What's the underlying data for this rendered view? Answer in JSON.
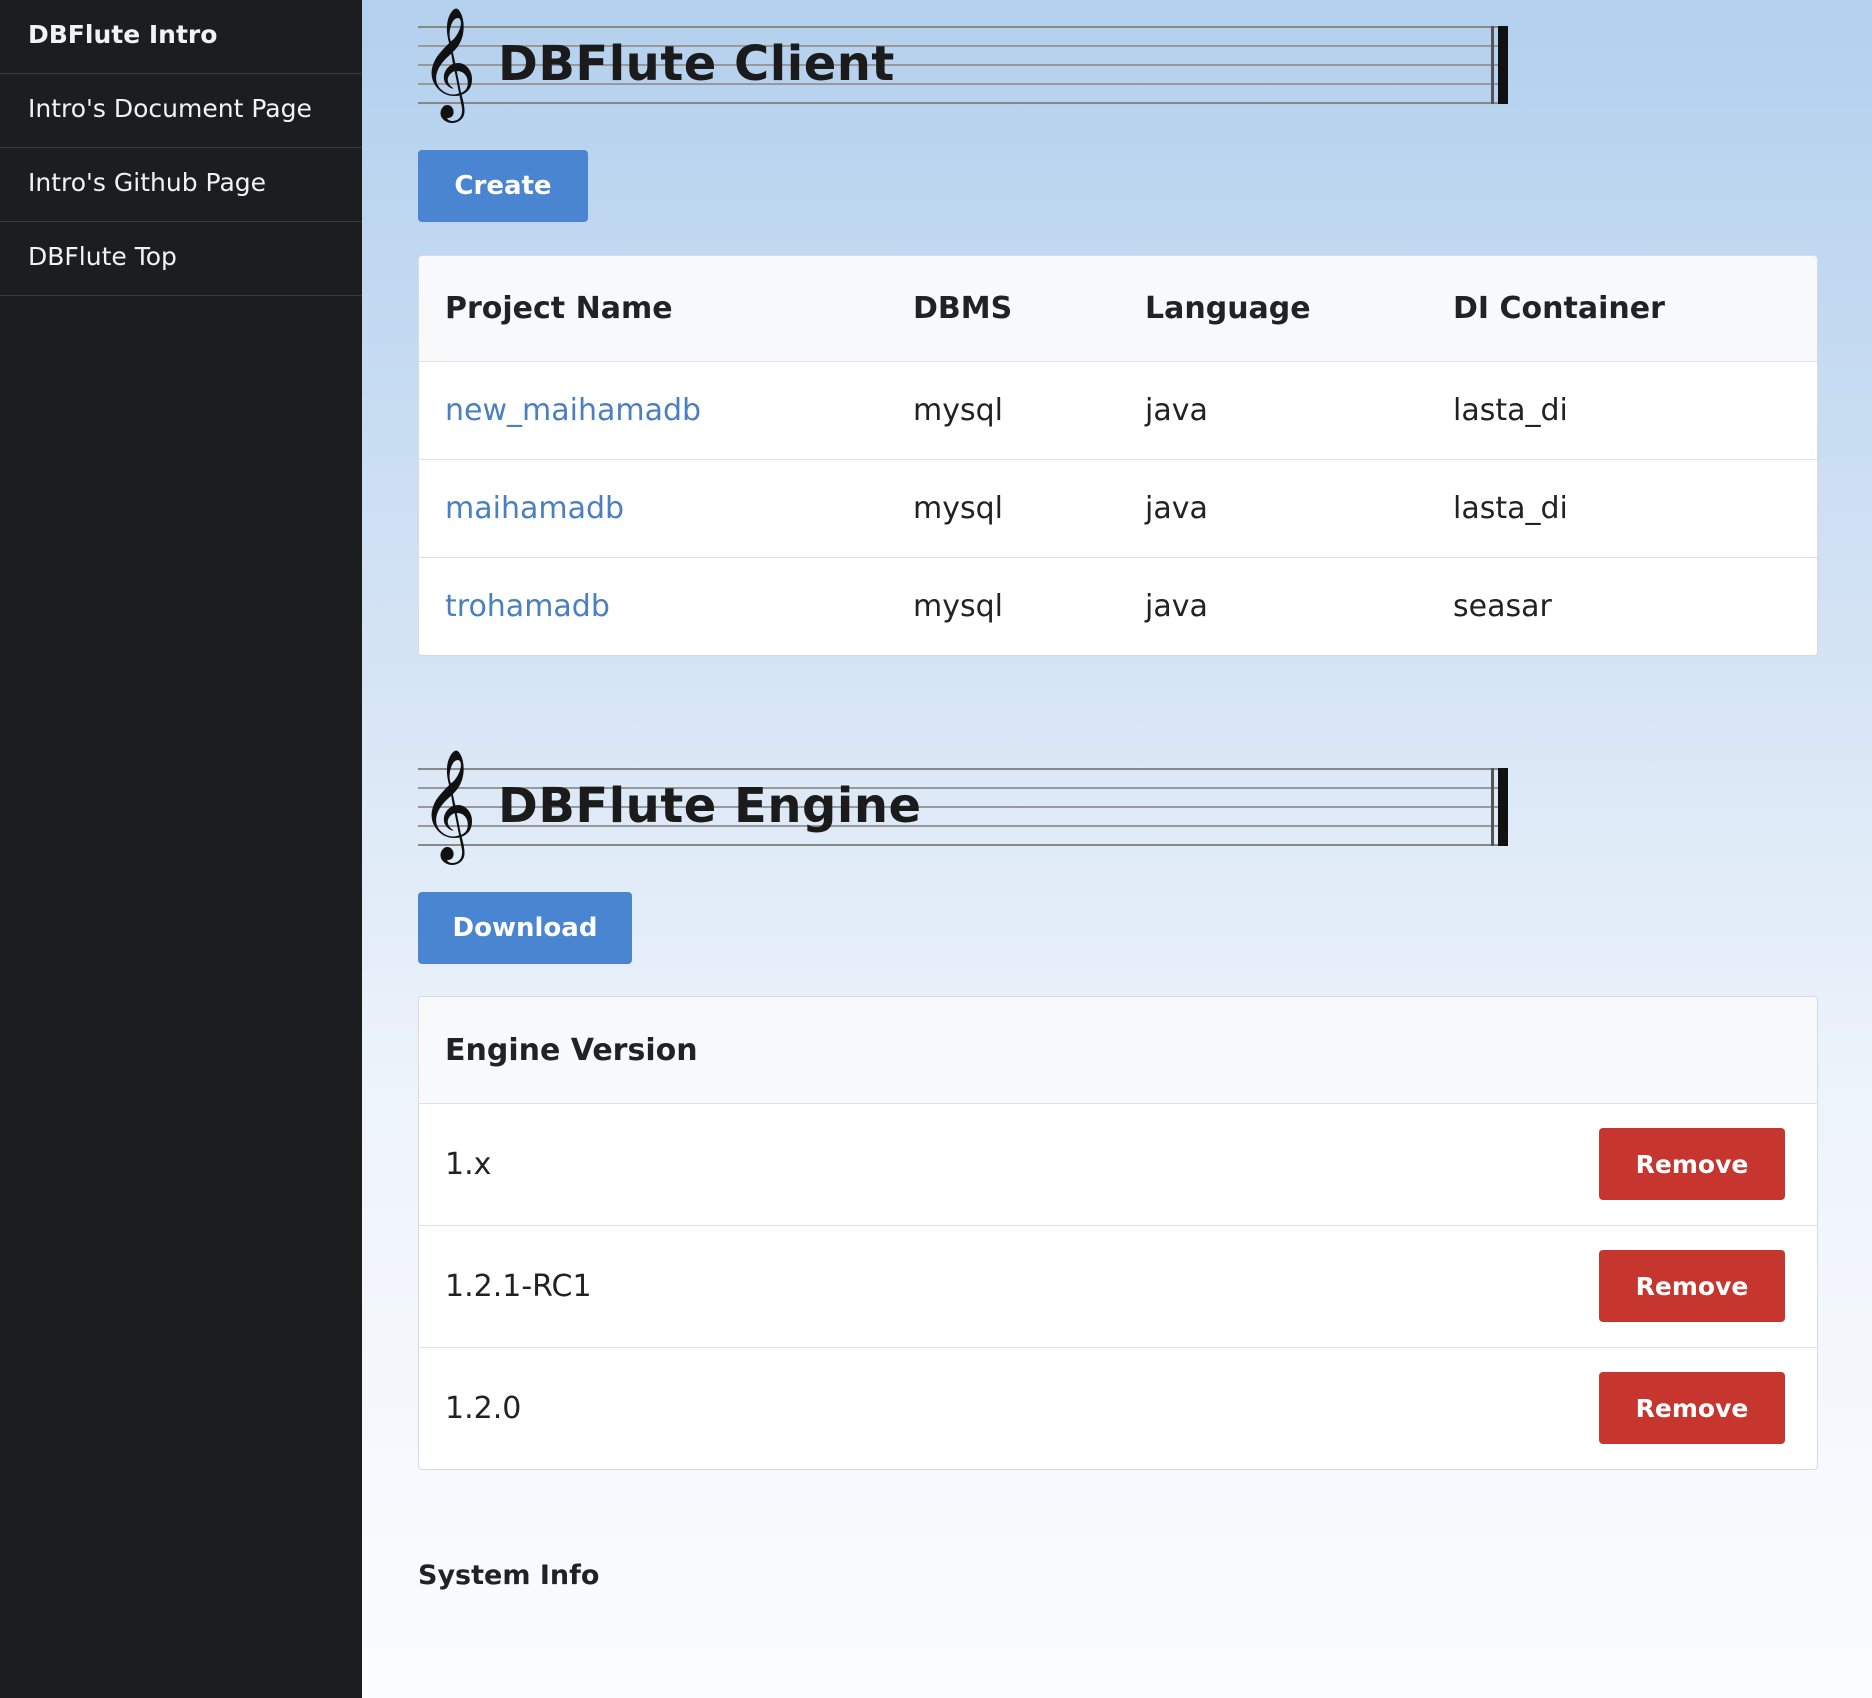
{
  "sidebar": {
    "items": [
      {
        "label": "DBFlute Intro"
      },
      {
        "label": "Intro's Document Page"
      },
      {
        "label": "Intro's Github Page"
      },
      {
        "label": "DBFlute Top"
      }
    ]
  },
  "client": {
    "title": "DBFlute Client",
    "create_label": "Create",
    "columns": [
      "Project Name",
      "DBMS",
      "Language",
      "DI Container"
    ],
    "rows": [
      {
        "project": "new_maihamadb",
        "dbms": "mysql",
        "language": "java",
        "di": "lasta_di"
      },
      {
        "project": "maihamadb",
        "dbms": "mysql",
        "language": "java",
        "di": "lasta_di"
      },
      {
        "project": "trohamadb",
        "dbms": "mysql",
        "language": "java",
        "di": "seasar"
      }
    ]
  },
  "engine": {
    "title": "DBFlute Engine",
    "download_label": "Download",
    "column": "Engine Version",
    "remove_label": "Remove",
    "versions": [
      "1.x",
      "1.2.1-RC1",
      "1.2.0"
    ]
  },
  "system_info": {
    "label": "System Info"
  },
  "icons": {
    "clef": "treble-clef-icon"
  },
  "colors": {
    "primary": "#4a85d1",
    "danger": "#c6362f",
    "link": "#4a7fc2",
    "sidebar_bg": "#1c1d1f"
  }
}
